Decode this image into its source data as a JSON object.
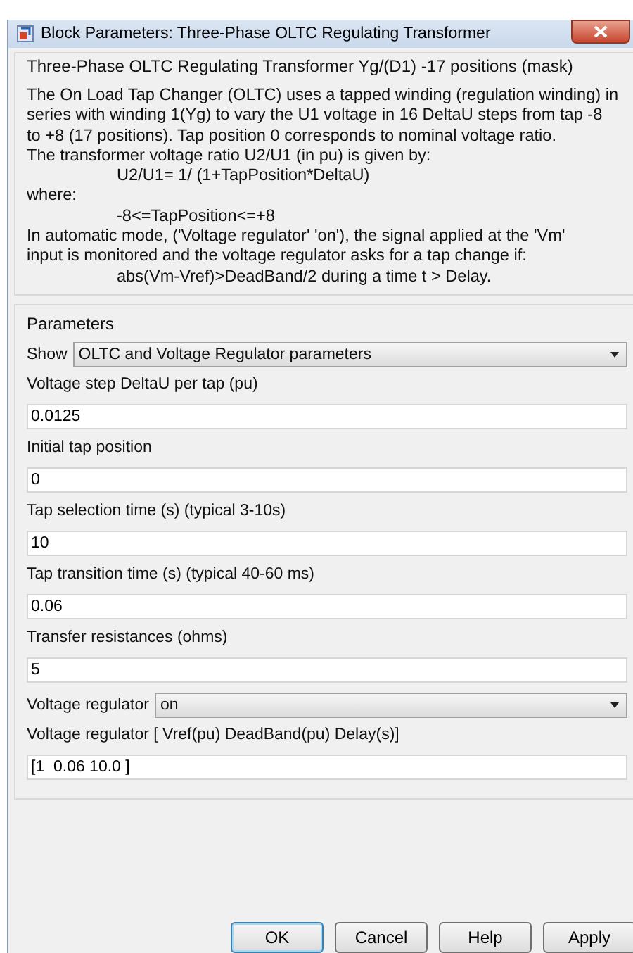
{
  "window": {
    "title": "Block Parameters: Three-Phase OLTC Regulating Transformer"
  },
  "mask_title": "Three-Phase OLTC Regulating Transformer Yg/(D1) -17 positions  (mask)",
  "description": [
    {
      "kind": "text",
      "text": "The On Load Tap Changer (OLTC) uses a tapped winding (regulation winding) in"
    },
    {
      "kind": "text",
      "text": "series with winding 1(Yg) to vary the U1 voltage in 16 DeltaU steps from tap -8"
    },
    {
      "kind": "text",
      "text": "to +8 (17 positions). Tap position 0 corresponds to nominal voltage ratio."
    },
    {
      "kind": "text",
      "text": "The transformer voltage ratio U2/U1 (in pu) is given by:"
    },
    {
      "kind": "indented",
      "text": "U2/U1= 1/ (1+TapPosition*DeltaU)"
    },
    {
      "kind": "text",
      "text": "where:"
    },
    {
      "kind": "indented",
      "text": "-8<=TapPosition<=+8"
    },
    {
      "kind": "text",
      "text": "In automatic mode, ('Voltage regulator'  'on'), the signal applied at the 'Vm'"
    },
    {
      "kind": "text",
      "text": "input is monitored and the voltage regulator asks for a tap change if:"
    },
    {
      "kind": "indented",
      "text": "abs(Vm-Vref)>DeadBand/2  during a time  t > Delay."
    }
  ],
  "parameters_title": "Parameters",
  "parameters": [
    {
      "kind": "popup",
      "label": "Show",
      "value": "OLTC and Voltage Regulator parameters"
    },
    {
      "kind": "edit",
      "label": "Voltage step DeltaU per tap (pu)",
      "value": "0.0125"
    },
    {
      "kind": "edit",
      "label": "Initial tap position",
      "value": "0"
    },
    {
      "kind": "edit",
      "label": "Tap selection time (s) (typical 3-10s)",
      "value": "10"
    },
    {
      "kind": "edit",
      "label": "Tap transition time (s) (typical 40-60 ms)",
      "value": "0.06"
    },
    {
      "kind": "edit",
      "label": "Transfer resistances  (ohms)",
      "value": "5"
    },
    {
      "kind": "popup",
      "label": "Voltage regulator",
      "value": "on"
    },
    {
      "kind": "edit",
      "label": "Voltage regulator [ Vref(pu) DeadBand(pu)  Delay(s)]",
      "value": "[1  0.06 10.0 ]"
    }
  ],
  "buttons": [
    {
      "label": "OK",
      "selected": true
    },
    {
      "label": "Cancel",
      "selected": false
    },
    {
      "label": "Help",
      "selected": false
    },
    {
      "label": "Apply",
      "selected": false
    }
  ]
}
